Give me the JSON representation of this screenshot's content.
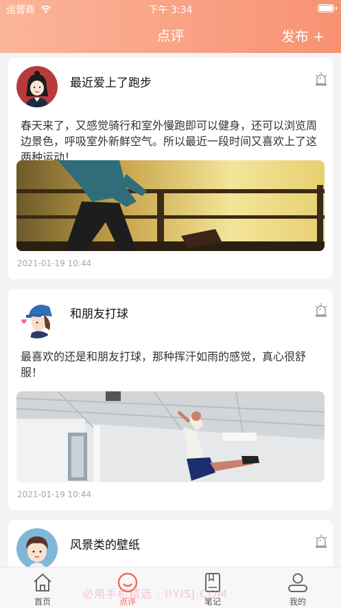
{
  "status_bar": {
    "carrier": "运营商",
    "time": "下午 3:34"
  },
  "header": {
    "title": "点评",
    "publish_label": "发布 +"
  },
  "posts": [
    {
      "title": "最近爱上了跑步",
      "body": "春天来了，又感觉骑行和室外慢跑即可以健身，还可以浏览周边景色，呼吸室外新鲜空气。所以最近一段时间又喜欢上了这两种运动！",
      "date": "2021-01-19 10:44"
    },
    {
      "title": "和朋友打球",
      "body": "最喜欢的还是和朋友打球，那种挥汗如雨的感觉，真心很舒服！",
      "date": "2021-01-19 10:44"
    },
    {
      "title": "风景类的壁纸"
    }
  ],
  "tabbar": {
    "items": [
      {
        "label": "首页",
        "icon": "home-icon"
      },
      {
        "label": "点评",
        "icon": "review-icon",
        "active": true
      },
      {
        "label": "笔记",
        "icon": "notebook-icon"
      },
      {
        "label": "我的",
        "icon": "profile-icon"
      }
    ]
  },
  "watermark": "必用手机精选 · IIYISJ.COM",
  "colors": {
    "accent": "#f79272",
    "tab_active": "#f0685a"
  }
}
